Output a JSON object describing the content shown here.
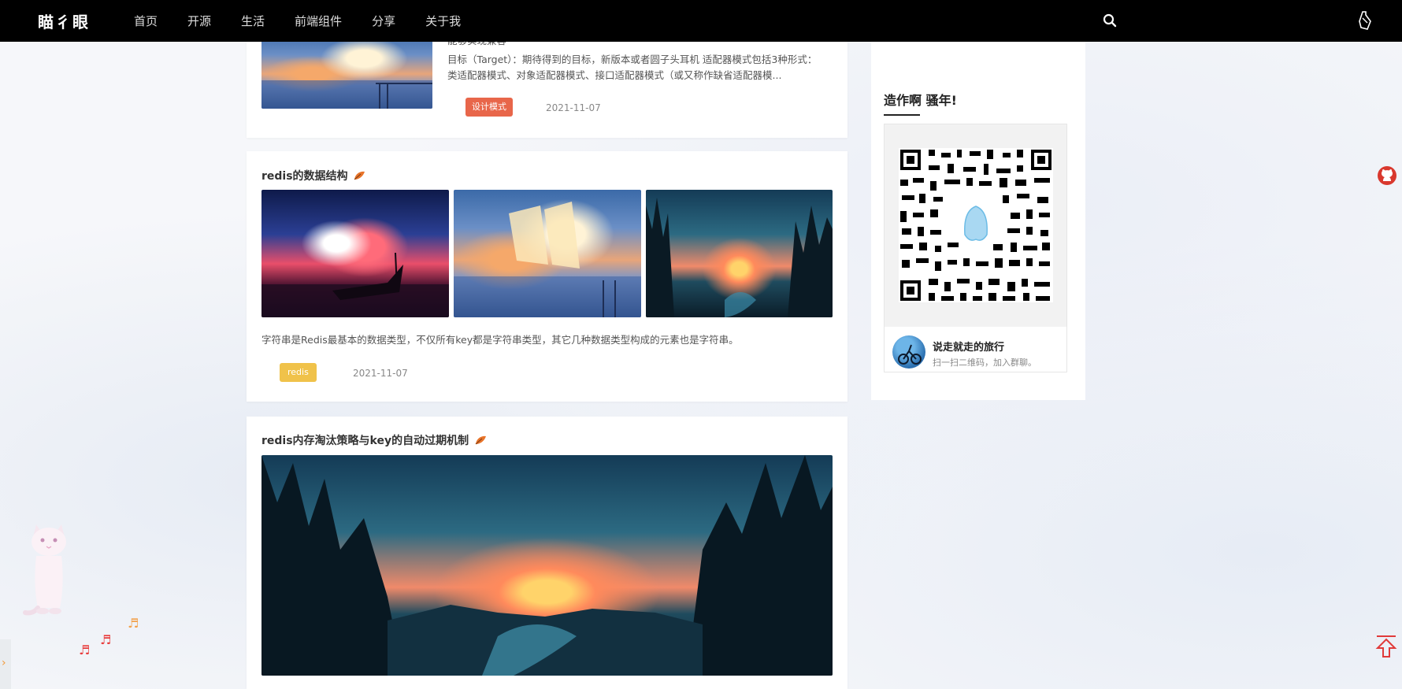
{
  "navbar": {
    "logo": "瞄彳眼",
    "menu": [
      "首页",
      "开源",
      "生活",
      "前端组件",
      "分享",
      "关于我"
    ]
  },
  "posts": [
    {
      "desc_line0": "能够实现兼容",
      "desc": "目标（Target）：期待得到的目标，新版本或者圆子头耳机 适配器模式包括3种形式：类适配器模式、对象适配器模式、接口适配器模式（或又称作缺省适配器模...",
      "tag": "设计模式",
      "date": "2021-11-07"
    },
    {
      "title": "redis的数据结构",
      "desc": "字符串是Redis最基本的数据类型，不仅所有key都是字符串类型，其它几种数据类型构成的元素也是字符串。",
      "tag": "redis",
      "date": "2021-11-07"
    },
    {
      "title": "redis内存淘汰策略与key的自动过期机制"
    }
  ],
  "sidebar": {
    "title": "造作啊 骚年!",
    "group_name": "说走就走的旅行",
    "group_sub": "扫一扫二维码，加入群聊。"
  },
  "colors": {
    "tag_design": "#e8664a",
    "tag_redis": "#f0c24a",
    "github": "#d9382e"
  },
  "icons": [
    "search-icon",
    "skin-icon",
    "github-icon",
    "back-to-top-icon",
    "leaf-icon",
    "music-note-icon"
  ]
}
